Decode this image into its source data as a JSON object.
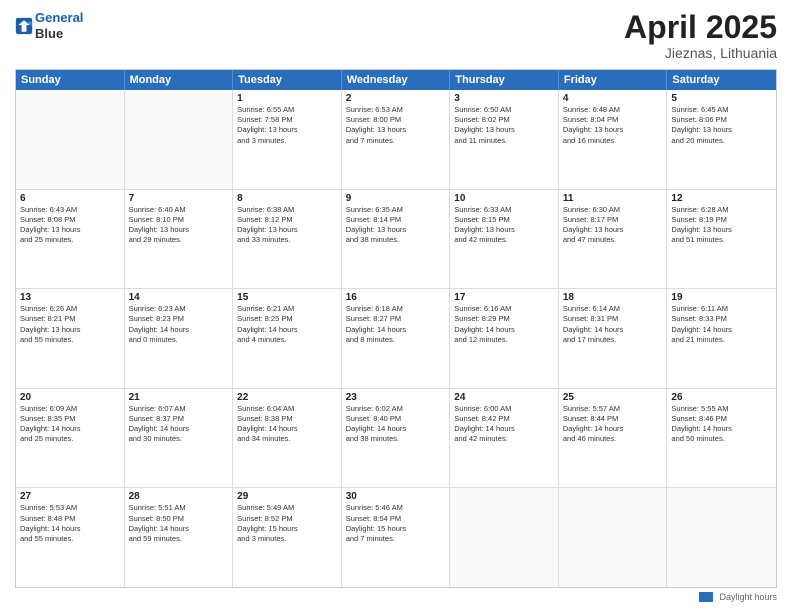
{
  "header": {
    "logo_line1": "General",
    "logo_line2": "Blue",
    "main_title": "April 2025",
    "subtitle": "Jieznas, Lithuania"
  },
  "days_of_week": [
    "Sunday",
    "Monday",
    "Tuesday",
    "Wednesday",
    "Thursday",
    "Friday",
    "Saturday"
  ],
  "footer": {
    "legend_label": "Daylight hours"
  },
  "weeks": [
    [
      {
        "day": "",
        "info": ""
      },
      {
        "day": "",
        "info": ""
      },
      {
        "day": "1",
        "info": "Sunrise: 6:55 AM\nSunset: 7:58 PM\nDaylight: 13 hours\nand 3 minutes."
      },
      {
        "day": "2",
        "info": "Sunrise: 6:53 AM\nSunset: 8:00 PM\nDaylight: 13 hours\nand 7 minutes."
      },
      {
        "day": "3",
        "info": "Sunrise: 6:50 AM\nSunset: 8:02 PM\nDaylight: 13 hours\nand 11 minutes."
      },
      {
        "day": "4",
        "info": "Sunrise: 6:48 AM\nSunset: 8:04 PM\nDaylight: 13 hours\nand 16 minutes."
      },
      {
        "day": "5",
        "info": "Sunrise: 6:45 AM\nSunset: 8:06 PM\nDaylight: 13 hours\nand 20 minutes."
      }
    ],
    [
      {
        "day": "6",
        "info": "Sunrise: 6:43 AM\nSunset: 8:08 PM\nDaylight: 13 hours\nand 25 minutes."
      },
      {
        "day": "7",
        "info": "Sunrise: 6:40 AM\nSunset: 8:10 PM\nDaylight: 13 hours\nand 29 minutes."
      },
      {
        "day": "8",
        "info": "Sunrise: 6:38 AM\nSunset: 8:12 PM\nDaylight: 13 hours\nand 33 minutes."
      },
      {
        "day": "9",
        "info": "Sunrise: 6:35 AM\nSunset: 8:14 PM\nDaylight: 13 hours\nand 38 minutes."
      },
      {
        "day": "10",
        "info": "Sunrise: 6:33 AM\nSunset: 8:15 PM\nDaylight: 13 hours\nand 42 minutes."
      },
      {
        "day": "11",
        "info": "Sunrise: 6:30 AM\nSunset: 8:17 PM\nDaylight: 13 hours\nand 47 minutes."
      },
      {
        "day": "12",
        "info": "Sunrise: 6:28 AM\nSunset: 8:19 PM\nDaylight: 13 hours\nand 51 minutes."
      }
    ],
    [
      {
        "day": "13",
        "info": "Sunrise: 6:26 AM\nSunset: 8:21 PM\nDaylight: 13 hours\nand 55 minutes."
      },
      {
        "day": "14",
        "info": "Sunrise: 6:23 AM\nSunset: 8:23 PM\nDaylight: 14 hours\nand 0 minutes."
      },
      {
        "day": "15",
        "info": "Sunrise: 6:21 AM\nSunset: 8:25 PM\nDaylight: 14 hours\nand 4 minutes."
      },
      {
        "day": "16",
        "info": "Sunrise: 6:18 AM\nSunset: 8:27 PM\nDaylight: 14 hours\nand 8 minutes."
      },
      {
        "day": "17",
        "info": "Sunrise: 6:16 AM\nSunset: 8:29 PM\nDaylight: 14 hours\nand 12 minutes."
      },
      {
        "day": "18",
        "info": "Sunrise: 6:14 AM\nSunset: 8:31 PM\nDaylight: 14 hours\nand 17 minutes."
      },
      {
        "day": "19",
        "info": "Sunrise: 6:11 AM\nSunset: 8:33 PM\nDaylight: 14 hours\nand 21 minutes."
      }
    ],
    [
      {
        "day": "20",
        "info": "Sunrise: 6:09 AM\nSunset: 8:35 PM\nDaylight: 14 hours\nand 25 minutes."
      },
      {
        "day": "21",
        "info": "Sunrise: 6:07 AM\nSunset: 8:37 PM\nDaylight: 14 hours\nand 30 minutes."
      },
      {
        "day": "22",
        "info": "Sunrise: 6:04 AM\nSunset: 8:38 PM\nDaylight: 14 hours\nand 34 minutes."
      },
      {
        "day": "23",
        "info": "Sunrise: 6:02 AM\nSunset: 8:40 PM\nDaylight: 14 hours\nand 38 minutes."
      },
      {
        "day": "24",
        "info": "Sunrise: 6:00 AM\nSunset: 8:42 PM\nDaylight: 14 hours\nand 42 minutes."
      },
      {
        "day": "25",
        "info": "Sunrise: 5:57 AM\nSunset: 8:44 PM\nDaylight: 14 hours\nand 46 minutes."
      },
      {
        "day": "26",
        "info": "Sunrise: 5:55 AM\nSunset: 8:46 PM\nDaylight: 14 hours\nand 50 minutes."
      }
    ],
    [
      {
        "day": "27",
        "info": "Sunrise: 5:53 AM\nSunset: 8:48 PM\nDaylight: 14 hours\nand 55 minutes."
      },
      {
        "day": "28",
        "info": "Sunrise: 5:51 AM\nSunset: 8:50 PM\nDaylight: 14 hours\nand 59 minutes."
      },
      {
        "day": "29",
        "info": "Sunrise: 5:49 AM\nSunset: 8:52 PM\nDaylight: 15 hours\nand 3 minutes."
      },
      {
        "day": "30",
        "info": "Sunrise: 5:46 AM\nSunset: 8:54 PM\nDaylight: 15 hours\nand 7 minutes."
      },
      {
        "day": "",
        "info": ""
      },
      {
        "day": "",
        "info": ""
      },
      {
        "day": "",
        "info": ""
      }
    ]
  ]
}
